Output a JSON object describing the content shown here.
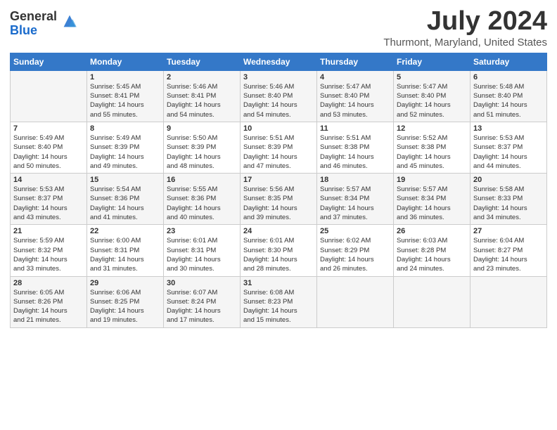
{
  "header": {
    "logo_general": "General",
    "logo_blue": "Blue",
    "month_title": "July 2024",
    "location": "Thurmont, Maryland, United States"
  },
  "days_of_week": [
    "Sunday",
    "Monday",
    "Tuesday",
    "Wednesday",
    "Thursday",
    "Friday",
    "Saturday"
  ],
  "weeks": [
    [
      {
        "day": "",
        "info": ""
      },
      {
        "day": "1",
        "info": "Sunrise: 5:45 AM\nSunset: 8:41 PM\nDaylight: 14 hours\nand 55 minutes."
      },
      {
        "day": "2",
        "info": "Sunrise: 5:46 AM\nSunset: 8:41 PM\nDaylight: 14 hours\nand 54 minutes."
      },
      {
        "day": "3",
        "info": "Sunrise: 5:46 AM\nSunset: 8:40 PM\nDaylight: 14 hours\nand 54 minutes."
      },
      {
        "day": "4",
        "info": "Sunrise: 5:47 AM\nSunset: 8:40 PM\nDaylight: 14 hours\nand 53 minutes."
      },
      {
        "day": "5",
        "info": "Sunrise: 5:47 AM\nSunset: 8:40 PM\nDaylight: 14 hours\nand 52 minutes."
      },
      {
        "day": "6",
        "info": "Sunrise: 5:48 AM\nSunset: 8:40 PM\nDaylight: 14 hours\nand 51 minutes."
      }
    ],
    [
      {
        "day": "7",
        "info": "Sunrise: 5:49 AM\nSunset: 8:40 PM\nDaylight: 14 hours\nand 50 minutes."
      },
      {
        "day": "8",
        "info": "Sunrise: 5:49 AM\nSunset: 8:39 PM\nDaylight: 14 hours\nand 49 minutes."
      },
      {
        "day": "9",
        "info": "Sunrise: 5:50 AM\nSunset: 8:39 PM\nDaylight: 14 hours\nand 48 minutes."
      },
      {
        "day": "10",
        "info": "Sunrise: 5:51 AM\nSunset: 8:39 PM\nDaylight: 14 hours\nand 47 minutes."
      },
      {
        "day": "11",
        "info": "Sunrise: 5:51 AM\nSunset: 8:38 PM\nDaylight: 14 hours\nand 46 minutes."
      },
      {
        "day": "12",
        "info": "Sunrise: 5:52 AM\nSunset: 8:38 PM\nDaylight: 14 hours\nand 45 minutes."
      },
      {
        "day": "13",
        "info": "Sunrise: 5:53 AM\nSunset: 8:37 PM\nDaylight: 14 hours\nand 44 minutes."
      }
    ],
    [
      {
        "day": "14",
        "info": "Sunrise: 5:53 AM\nSunset: 8:37 PM\nDaylight: 14 hours\nand 43 minutes."
      },
      {
        "day": "15",
        "info": "Sunrise: 5:54 AM\nSunset: 8:36 PM\nDaylight: 14 hours\nand 41 minutes."
      },
      {
        "day": "16",
        "info": "Sunrise: 5:55 AM\nSunset: 8:36 PM\nDaylight: 14 hours\nand 40 minutes."
      },
      {
        "day": "17",
        "info": "Sunrise: 5:56 AM\nSunset: 8:35 PM\nDaylight: 14 hours\nand 39 minutes."
      },
      {
        "day": "18",
        "info": "Sunrise: 5:57 AM\nSunset: 8:34 PM\nDaylight: 14 hours\nand 37 minutes."
      },
      {
        "day": "19",
        "info": "Sunrise: 5:57 AM\nSunset: 8:34 PM\nDaylight: 14 hours\nand 36 minutes."
      },
      {
        "day": "20",
        "info": "Sunrise: 5:58 AM\nSunset: 8:33 PM\nDaylight: 14 hours\nand 34 minutes."
      }
    ],
    [
      {
        "day": "21",
        "info": "Sunrise: 5:59 AM\nSunset: 8:32 PM\nDaylight: 14 hours\nand 33 minutes."
      },
      {
        "day": "22",
        "info": "Sunrise: 6:00 AM\nSunset: 8:31 PM\nDaylight: 14 hours\nand 31 minutes."
      },
      {
        "day": "23",
        "info": "Sunrise: 6:01 AM\nSunset: 8:31 PM\nDaylight: 14 hours\nand 30 minutes."
      },
      {
        "day": "24",
        "info": "Sunrise: 6:01 AM\nSunset: 8:30 PM\nDaylight: 14 hours\nand 28 minutes."
      },
      {
        "day": "25",
        "info": "Sunrise: 6:02 AM\nSunset: 8:29 PM\nDaylight: 14 hours\nand 26 minutes."
      },
      {
        "day": "26",
        "info": "Sunrise: 6:03 AM\nSunset: 8:28 PM\nDaylight: 14 hours\nand 24 minutes."
      },
      {
        "day": "27",
        "info": "Sunrise: 6:04 AM\nSunset: 8:27 PM\nDaylight: 14 hours\nand 23 minutes."
      }
    ],
    [
      {
        "day": "28",
        "info": "Sunrise: 6:05 AM\nSunset: 8:26 PM\nDaylight: 14 hours\nand 21 minutes."
      },
      {
        "day": "29",
        "info": "Sunrise: 6:06 AM\nSunset: 8:25 PM\nDaylight: 14 hours\nand 19 minutes."
      },
      {
        "day": "30",
        "info": "Sunrise: 6:07 AM\nSunset: 8:24 PM\nDaylight: 14 hours\nand 17 minutes."
      },
      {
        "day": "31",
        "info": "Sunrise: 6:08 AM\nSunset: 8:23 PM\nDaylight: 14 hours\nand 15 minutes."
      },
      {
        "day": "",
        "info": ""
      },
      {
        "day": "",
        "info": ""
      },
      {
        "day": "",
        "info": ""
      }
    ]
  ]
}
